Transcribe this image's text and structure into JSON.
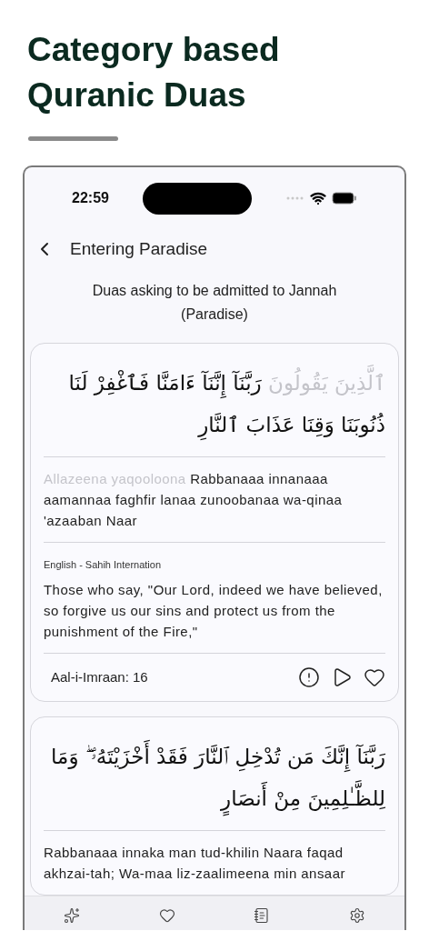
{
  "heading": "Category based Quranic Duas",
  "status_bar": {
    "time": "22:59"
  },
  "nav": {
    "title": "Entering Paradise"
  },
  "subtitle": "Duas asking to be admitted to Jannah (Paradise)",
  "duas": [
    {
      "arabic_context": "ٱلَّذِينَ يَقُولُونَ",
      "arabic": "رَبَّنَآ إِنَّنَآ ءَامَنَّا فَٱغْفِرْ لَنَا ذُنُوبَنَا وَقِنَا عَذَابَ ٱلنَّارِ",
      "transliteration_context": "Allazeena yaqooloona",
      "transliteration": "Rabbanaaa innanaaa aamannaa faghfir lanaa zunoobanaa wa-qinaa 'azaaban Naar",
      "translation_source": "English - Sahih Internation",
      "translation": "Those who say, \"Our Lord, indeed we have believed, so forgive us our sins and protect us from the punishment of the Fire,\"",
      "reference": "Aal-i-Imraan: 16"
    },
    {
      "arabic": "رَبَّنَآ إِنَّكَ مَن تُدْخِلِ ٱلنَّارَ فَقَدْ أَخْزَيْتَهُۥ ۖ وَمَا لِلظَّـٰلِمِينَ مِنْ أَنصَارٍ",
      "transliteration": "Rabbanaaa innaka man tud-khilin Naara faqad akhzai-tah; Wa-maa liz-zaalimeena min ansaar"
    }
  ]
}
